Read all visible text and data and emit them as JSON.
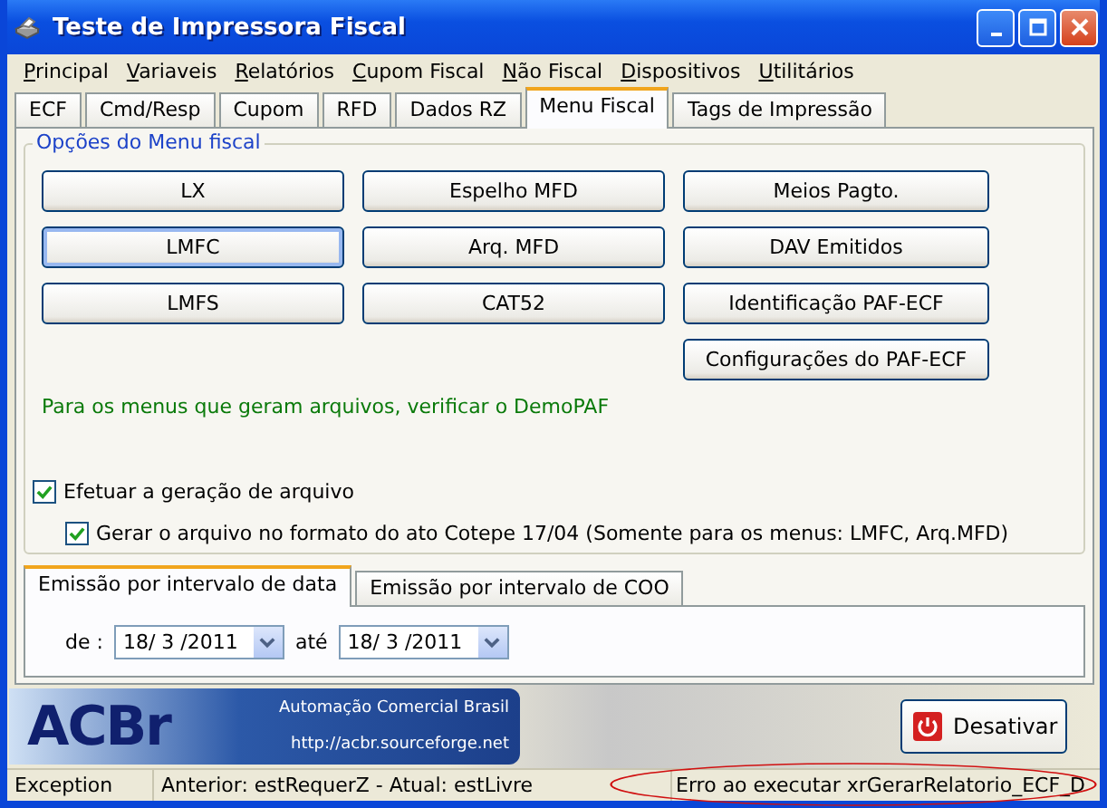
{
  "window": {
    "title": "Teste de Impressora Fiscal"
  },
  "menu": [
    "Principal",
    "Variaveis",
    "Relatórios",
    "Cupom Fiscal",
    "Não Fiscal",
    "Dispositivos",
    "Utilitários"
  ],
  "tabs": [
    {
      "label": "ECF",
      "selected": false
    },
    {
      "label": "Cmd/Resp",
      "selected": false
    },
    {
      "label": "Cupom",
      "selected": false
    },
    {
      "label": "RFD",
      "selected": false
    },
    {
      "label": "Dados RZ",
      "selected": false
    },
    {
      "label": "Menu Fiscal",
      "selected": true
    },
    {
      "label": "Tags de Impressão",
      "selected": false
    }
  ],
  "group": {
    "title": "Opções do Menu fiscal",
    "buttons": [
      {
        "label": "LX",
        "focused": false
      },
      {
        "label": "Espelho MFD",
        "focused": false
      },
      {
        "label": "Meios Pagto.",
        "focused": false
      },
      {
        "label": "LMFC",
        "focused": true
      },
      {
        "label": "Arq. MFD",
        "focused": false
      },
      {
        "label": "DAV Emitidos",
        "focused": false
      },
      {
        "label": "LMFS",
        "focused": false
      },
      {
        "label": "CAT52",
        "focused": false
      },
      {
        "label": "Identificação PAF-ECF",
        "focused": false
      },
      {
        "label": "Configurações do PAF-ECF",
        "focused": false
      }
    ],
    "note": "Para os menus que geram arquivos, verificar o DemoPAF"
  },
  "checkboxes": [
    {
      "label": "Efetuar a geração de arquivo",
      "checked": true
    },
    {
      "label": "Gerar o arquivo no formato do ato Cotepe 17/04 (Somente para os menus: LMFC, Arq.MFD)",
      "checked": true
    }
  ],
  "sub_tabs": [
    {
      "label": "Emissão por intervalo de data",
      "selected": true
    },
    {
      "label": "Emissão por intervalo de COO",
      "selected": false
    }
  ],
  "date_range": {
    "from_label": "de :",
    "from": "18/ 3 /2011",
    "to_label": "até",
    "to": "18/ 3 /2011"
  },
  "banner": {
    "logo_text": "ACBr",
    "tagline": "Automação Comercial Brasil",
    "url": "http://acbr.sourceforge.net"
  },
  "deactivate_button": "Desativar",
  "status_bar": [
    "Exception",
    "Anterior: estRequerZ - Atual: estLivre",
    "Erro ao executar xrGerarRelatorio_ECF_D"
  ]
}
